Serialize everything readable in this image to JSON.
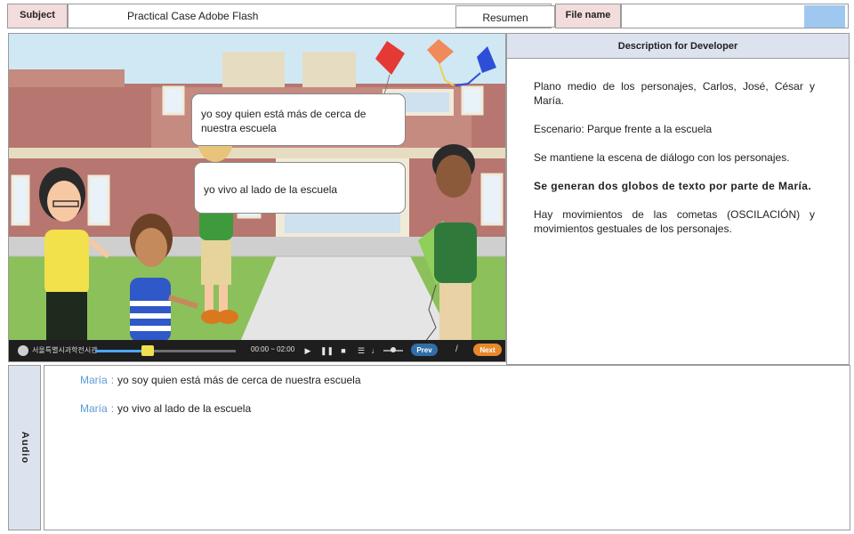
{
  "header": {
    "subject_label": "Subject",
    "title": "Practical Case Adobe Flash",
    "resumen_label": "Resumen",
    "file_name_label": "File name",
    "file_name_value": "",
    "swatch_color": "#9fc8f0"
  },
  "scene": {
    "bubbles": [
      "yo soy quien está más de cerca de nuestra escuela",
      "yo vivo al lado de la escuela"
    ],
    "player": {
      "organization": "서울특별시과학전시관",
      "time": "00:00 ~ 02:00",
      "progress": 0.38,
      "prev_label": "Prev",
      "separator": "/",
      "next_label": "Next",
      "controls": [
        "play-icon",
        "pause-icon",
        "stop-icon",
        "menu-icon",
        "volume-icon"
      ]
    }
  },
  "description": {
    "title": "Description for Developer",
    "paragraphs": [
      "Plano medio de los personajes, Carlos, José, César y María.",
      "Escenario: Parque frente a la escuela",
      "Se mantiene la escena de diálogo con los personajes.",
      "Se generan dos globos de texto por parte de María.",
      "Hay movimientos de las cometas (OSCILACIÓN) y movimientos gestuales de los personajes."
    ]
  },
  "audio": {
    "label": "Audio",
    "lines": [
      {
        "speaker": "María",
        "text": "yo soy quien está más de cerca de nuestra escuela"
      },
      {
        "speaker": "María",
        "text": "yo vivo al lado de la escuela"
      }
    ],
    "speaker_color": "#5b9bd5"
  }
}
